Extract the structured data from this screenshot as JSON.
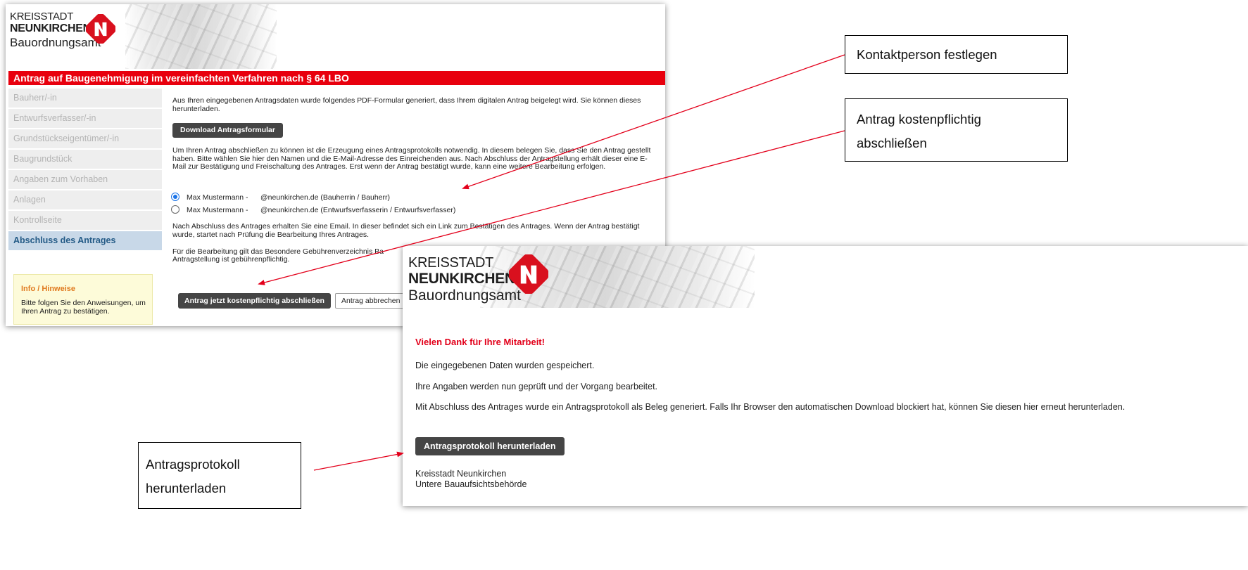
{
  "screenshot1": {
    "logo": {
      "line1": "KREISSTADT",
      "line2": "NEUNKIRCHEN",
      "line3": "Bauordnungsamt"
    },
    "title": "Antrag auf Baugenehmigung im vereinfachten Verfahren nach § 64 LBO",
    "sidebar": {
      "items": [
        {
          "label": "Bauherr/-in",
          "active": false
        },
        {
          "label": "Entwurfsverfasser/-in",
          "active": false
        },
        {
          "label": "Grundstückseigentümer/-in",
          "active": false
        },
        {
          "label": "Baugrundstück",
          "active": false
        },
        {
          "label": "Angaben zum Vorhaben",
          "active": false
        },
        {
          "label": "Anlagen",
          "active": false
        },
        {
          "label": "Kontrollseite",
          "active": false
        },
        {
          "label": "Abschluss des Antrages",
          "active": true
        }
      ]
    },
    "info": {
      "heading": "Info / Hinweise",
      "text": "Bitte folgen Sie den Anweisungen, um Ihren Antrag zu bestätigen."
    },
    "main": {
      "intro_text": "Aus Ihren eingegebenen Antragsdaten wurde folgendes PDF-Formular generiert, dass Ihrem digitalen Antrag beigelegt wird. Sie können dieses herunterladen.",
      "download_button": "Download Antragsformular",
      "protocol_text": "Um Ihren Antrag abschließen zu können ist die Erzeugung eines Antragsprotokolls notwendig. In diesem belegen Sie, dass Sie den Antrag gestellt haben. Bitte wählen Sie hier den Namen und die E-Mail-Adresse des Einreichenden aus. Nach Abschluss der Antragstellung erhält dieser eine E-Mail zur Bestätigung und Freischaltung des Antrages. Erst wenn der Antrag bestätigt wurde, kann eine weitere Bearbeitung erfolgen.",
      "radio_options": [
        {
          "name": "Max Mustermann -",
          "email": "@neunkirchen.de (Bauherrin / Bauherr)",
          "checked": true
        },
        {
          "name": "Max Mustermann -",
          "email": "@neunkirchen.de (Entwurfsverfasserin / Entwurfsverfasser)",
          "checked": false
        }
      ],
      "email_text": "Nach Abschluss des Antrages erhalten Sie eine Email. In dieser befindet sich ein Link zum Bestätigen des Antrages. Wenn der Antrag bestätigt wurde, startet nach Prüfung die Bearbeitung Ihres Antrages.",
      "fee_text": "Für die Bearbeitung gilt das Besondere Gebührenverzeichnis Ba",
      "fee_text_2": "Antragstellung ist gebührenpflichtig.",
      "submit_button": "Antrag jetzt kostenpflichtig abschließen",
      "cancel_button": "Antrag abbrechen"
    }
  },
  "screenshot2": {
    "logo": {
      "line1": "KREISSTADT",
      "line2": "NEUNKIRCHEN",
      "line3": "Bauordnungsamt"
    },
    "heading": "Vielen Dank für Ihre Mitarbeit!",
    "saved_text": "Die eingegebenen Daten wurden gespeichert.",
    "review_text": "Ihre Angaben werden nun geprüft und der Vorgang bearbeitet.",
    "download_text": "Mit Abschluss des Antrages wurde ein Antragsprotokoll als Beleg generiert. Falls Ihr Browser den automatischen Download blockiert hat, können Sie diesen hier erneut herunterladen.",
    "download_button": "Antragsprotokoll herunterladen",
    "footer_line1": "Kreisstadt Neunkirchen",
    "footer_line2": "Untere Bauaufsichtsbehörde"
  },
  "callouts": {
    "contact": "Kontaktperson festlegen",
    "submit_line1": "Antrag kostenpflichtig",
    "submit_line2": "abschließen",
    "protocol_line1": "Antragsprotokoll",
    "protocol_line2": "herunterladen"
  },
  "colors": {
    "title_bar": "#e8000e",
    "emblem_red": "#d9101e",
    "heading_red": "#e2001a",
    "active_nav": "#235a86",
    "arrow": "#e3001b"
  }
}
